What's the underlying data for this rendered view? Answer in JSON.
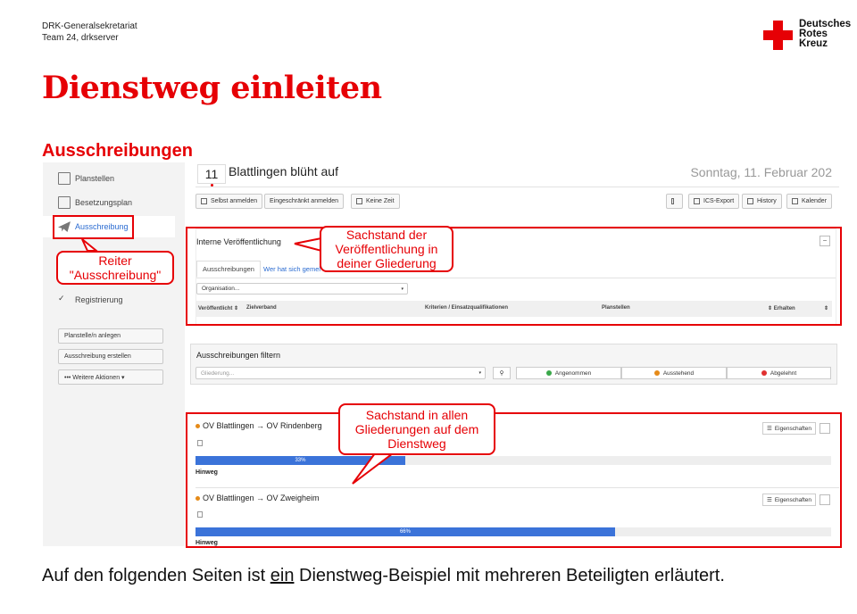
{
  "header": {
    "org_line1": "DRK-Generalsekretariat",
    "org_line2": "Team 24, drkserver",
    "logo_line1": "Deutsches",
    "logo_line2": "Rotes",
    "logo_line3": "Kreuz"
  },
  "page": {
    "title": "Dienstweg einleiten",
    "subtitle": "Ausschreibungen",
    "bottom_before": "Auf den folgenden Seiten ist ",
    "bottom_underlined": "ein",
    "bottom_after": " Dienstweg-Beispiel mit mehreren Beteiligten erläutert."
  },
  "sidebar": {
    "items": [
      {
        "label": "Planstellen",
        "icon": "clipboard-icon"
      },
      {
        "label": "Besetzungsplan",
        "icon": "grid-icon"
      },
      {
        "label": "Ausschreibung",
        "icon": "paper-plane-icon"
      },
      {
        "label": "Registrierung",
        "icon": "checklist-icon"
      }
    ],
    "buttons": [
      "Planstelle/n anlegen",
      "Ausschreibung erstellen",
      "••• Weitere Aktionen ▾"
    ]
  },
  "event": {
    "day": "11",
    "title": "Blattlingen blüht auf",
    "date": "Sonntag, 11. Februar 202"
  },
  "toolbar": {
    "selbst": "Selbst anmelden",
    "eingeschraenkt": "Eingeschränkt anmelden",
    "keine_zeit": "Keine Zeit",
    "ics": "ICS-Export",
    "history": "History",
    "kalender": "Kalender"
  },
  "internal": {
    "title": "Interne Veröffentlichung",
    "tab1": "Ausschreibungen",
    "tab2": "Wer hat sich gemel",
    "org_select": "Organisation...",
    "columns": [
      "Veröffentlicht ⇕",
      "Zielverband",
      "Kriterien / Einsatzqualifikationen",
      "Planstellen",
      "⇕  Erhalten",
      "⇕"
    ]
  },
  "filter": {
    "title": "Ausschreibungen filtern",
    "placeholder": "Gliederung...",
    "buttons": [
      {
        "label": "Angenommen",
        "color": "#3aa84a"
      },
      {
        "label": "Ausstehend",
        "color": "#e58a18"
      },
      {
        "label": "Abgelehnt",
        "color": "#e03030"
      }
    ]
  },
  "routes": [
    {
      "label": "OV Blattlingen → OV Rindenberg",
      "progress_label": "33%",
      "progress": 0.33,
      "hinweis": "Hinweg",
      "eig": "Eigenschaften"
    },
    {
      "label": "OV Blattlingen → OV Zweigheim",
      "progress_label": "66%",
      "progress": 0.66,
      "hinweis": "Hinweg",
      "eig": "Eigenschaften"
    }
  ],
  "callouts": {
    "reiter_line1": "Reiter",
    "reiter_line2": "\"Ausschreibung\"",
    "sachstand1_line1": "Sachstand der",
    "sachstand1_line2": "Veröffentlichung in",
    "sachstand1_line3": "deiner Gliederung",
    "sachstand2_line1": "Sachstand in allen",
    "sachstand2_line2": "Gliederungen auf dem",
    "sachstand2_line3": "Dienstweg"
  },
  "colors": {
    "drk_red": "#e60005",
    "link_blue": "#2a6bd1",
    "progress_blue": "#3b73d9"
  }
}
